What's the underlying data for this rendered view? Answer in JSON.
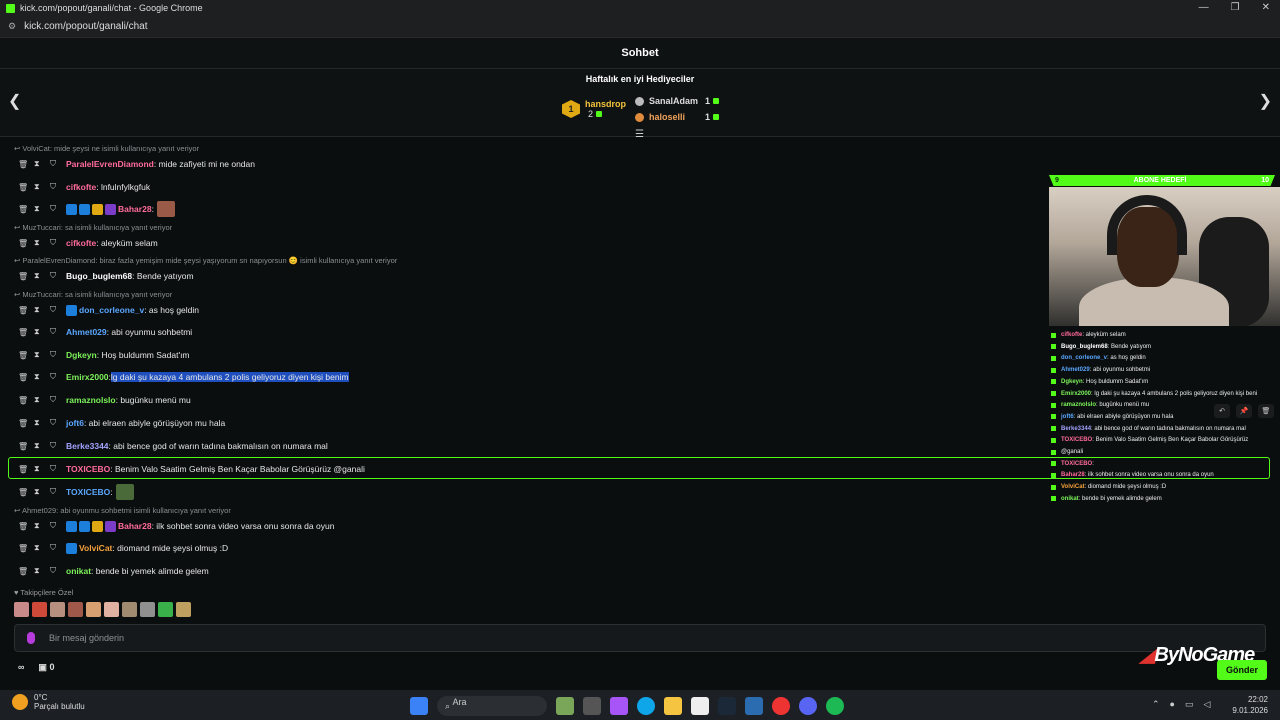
{
  "window": {
    "title": "kick.com/popout/ganali/chat - Google Chrome",
    "url": "kick.com/popout/ganali/chat"
  },
  "header": {
    "title": "Sohbet"
  },
  "gifters": {
    "title": "Haftalık en iyi Hediyeciler",
    "first": {
      "rank": "1",
      "name": "hansdrop",
      "count": "2"
    },
    "second": {
      "name": "SanalAdam",
      "count": "1"
    },
    "third": {
      "name": "haloselli",
      "count": "1"
    }
  },
  "chat": {
    "replies": [
      "VolviCat: mide şeysi ne isimli kullanıcıya yanıt veriyor",
      "MuzTuccari: sa isimli kullanıcıya yanıt veriyor",
      "ParalelEvrenDiamond: biraz fazla yemişim mide şeysi yaşıyorum sn napıyorsun 😊 isimli kullanıcıya yanıt veriyor",
      "MuzTuccari: sa isimli kullanıcıya yanıt veriyor",
      "Ahmet029: abi oyunmu sohbetmi isimli kullanıcıya yanıt veriyor"
    ],
    "messages": [
      {
        "user": "ParalelEvrenDiamond",
        "text": ": mide zafiyeti mi ne ondan",
        "color": "#ff6b9a"
      },
      {
        "user": "cifkofte",
        "text": ": lnfulnfylkgfuk",
        "color": "#ff6b9a"
      },
      {
        "user": "Bahar28",
        "text": ":",
        "color": "#ff6b9a"
      },
      {
        "user": "cifkofte",
        "text": ": aleyküm selam",
        "color": "#ff6b9a"
      },
      {
        "user": "Bugo_buglem68",
        "text": ": Bende yatıyom",
        "color": "#ffffff"
      },
      {
        "user": "don_corleone_v",
        "text": ": as hoş geldin",
        "color": "#5aa7ff"
      },
      {
        "user": "Ahmet029",
        "text": ": abi oyunmu sohbetmi",
        "color": "#5aa7ff"
      },
      {
        "user": "Dgkeyn",
        "text": ": Hoş buldumm Sadat'ım",
        "color": "#7cf25a"
      },
      {
        "user": "Emirx2000",
        "text": ": ",
        "highlighted": "lg daki şu kazaya 4 ambulans 2 polis geliyoruz diyen kişi benim",
        "color": "#7cf25a"
      },
      {
        "user": "ramaznolslo",
        "text": ": bugünku menü mu",
        "color": "#7cf25a"
      },
      {
        "user": "joft6",
        "text": ": abi elraen abiyle görüşüyon mu hala",
        "color": "#5aa7ff"
      },
      {
        "user": "Berke3344",
        "text": ": abi bence god of warın tadına bakmalısın on numara mal",
        "color": "#a3a3ff"
      },
      {
        "user": "TOXICEBO",
        "text": ": Benim Valo Saatim Gelmiş Ben Kaçar Babolar Görüşürüz @ganali",
        "color": "#ff6b9a"
      },
      {
        "user": "TOXICEBO",
        "text": ":",
        "color": "#5aa7ff"
      },
      {
        "user": "Bahar28",
        "text": ": ilk sohbet sonra video varsa onu sonra da oyun",
        "color": "#ff6b9a"
      },
      {
        "user": "VolviCat",
        "text": ": diomand mide şeysi olmuş :D",
        "color": "#f7a23c"
      },
      {
        "user": "onikat",
        "text": ": bende bi yemek alimde gelem",
        "color": "#7cf25a"
      }
    ],
    "followers_label": "Takipçilere Özel",
    "input_placeholder": "Bir mesaj gönderin",
    "send_label": "Gönder",
    "footer_count": "0",
    "footer_left": "∞"
  },
  "overlay": {
    "goal_left": "9",
    "goal_label": "ABONE HEDEFİ",
    "goal_right": "10",
    "mini_chat": [
      {
        "user": "cifkofte",
        "text": ": aleyküm selam",
        "color": "#ff6b9a"
      },
      {
        "user": "Bugo_buglem68",
        "text": ": Bende yatıyom",
        "color": "#ffffff"
      },
      {
        "user": "don_corleone_v",
        "text": ": as hoş geldin",
        "color": "#5aa7ff"
      },
      {
        "user": "Ahmet029",
        "text": ": abi oyunmu sohbetmi",
        "color": "#5aa7ff"
      },
      {
        "user": "Dgkeyn",
        "text": ": Hoş buldumm Sadat'ım",
        "color": "#7cf25a"
      },
      {
        "user": "Emirx2000",
        "text": ": lg daki şu kazaya 4 ambulans 2 polis geliyoruz diyen kişi beni",
        "color": "#7cf25a"
      },
      {
        "user": "ramaznolslo",
        "text": ": bugünku menü mu",
        "color": "#7cf25a"
      },
      {
        "user": "joft6",
        "text": ": abi elraen abiyle görüşüyon mu hala",
        "color": "#5aa7ff"
      },
      {
        "user": "Berke3344",
        "text": ": abi bence god of warın tadına bakmalısın on numara mal",
        "color": "#a3a3ff"
      },
      {
        "user": "TOXICEBO",
        "text": ": Benim Valo Saatim Gelmiş Ben Kaçar Babolar Görüşürüz",
        "color": "#ff6b9a"
      },
      {
        "user": "",
        "text": "@ganali",
        "color": "#ffffff"
      },
      {
        "user": "TOXICEBO",
        "text": ":",
        "color": "#ff6b9a"
      },
      {
        "user": "Bahar28",
        "text": ": ilk sohbet sonra video varsa onu sonra da oyun",
        "color": "#ff6b9a"
      },
      {
        "user": "VolviCat",
        "text": ": diomand mide şeysi olmuş :D",
        "color": "#f7a23c"
      },
      {
        "user": "onikat",
        "text": ": bende bi yemek alimde gelem",
        "color": "#7cf25a"
      }
    ],
    "logo": "ByNoGame"
  },
  "taskbar": {
    "temp": "0°C",
    "weather": "Parçalı bulutlu",
    "search": "Ara",
    "time": "22:02",
    "date": "9.01.2026"
  }
}
